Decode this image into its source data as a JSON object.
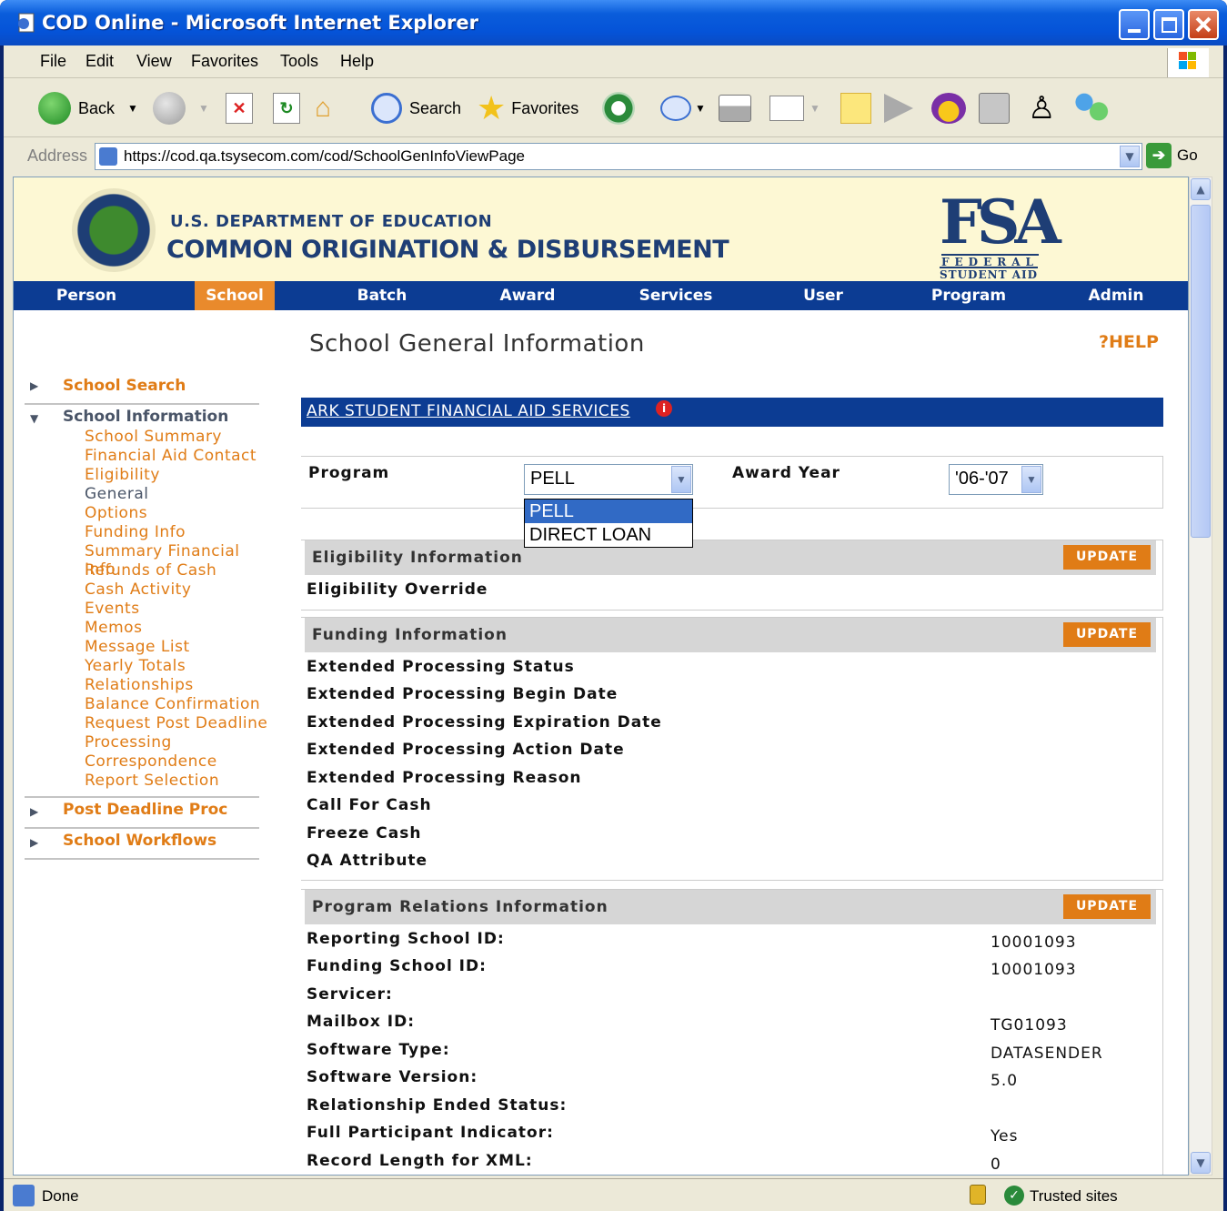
{
  "window": {
    "title": "COD Online - Microsoft Internet Explorer"
  },
  "menu": [
    "File",
    "Edit",
    "View",
    "Favorites",
    "Tools",
    "Help"
  ],
  "toolbar": {
    "back": "Back",
    "search": "Search",
    "favorites": "Favorites"
  },
  "address": {
    "label": "Address",
    "url": "https://cod.qa.tsysecom.com/cod/SchoolGenInfoViewPage",
    "go": "Go"
  },
  "banner": {
    "dept": "U.S. DEPARTMENT OF EDUCATION",
    "title": "COMMON ORIGINATION & DISBURSEMENT",
    "fsa": "FSA",
    "fsa_line1": "FEDERAL",
    "fsa_line2": "STUDENT AID"
  },
  "nav": [
    "Person",
    "School",
    "Batch",
    "Award",
    "Services",
    "User",
    "Program",
    "Admin"
  ],
  "nav_active": "School",
  "sidebar": {
    "school_search": "School Search",
    "school_information": "School Information",
    "links": [
      "School Summary",
      "Financial Aid Contact",
      "Eligibility",
      "General",
      "Options",
      "Funding Info",
      "Summary Financial Info",
      "Refunds of Cash",
      "Cash Activity",
      "Events",
      "Memos",
      "Message List",
      "Yearly Totals",
      "Relationships",
      "Balance Confirmation",
      "Request Post Deadline",
      "Processing",
      "Correspondence",
      "Report Selection"
    ],
    "post_deadline": "Post Deadline Proc",
    "school_workflows": "School Workflows"
  },
  "main": {
    "title": "School General Information",
    "help": "HELP",
    "school_name": "ARK STUDENT FINANCIAL AID SERVICES",
    "program_label": "Program",
    "program_value": "PELL",
    "program_options": [
      "PELL",
      "DIRECT LOAN"
    ],
    "award_year_label": "Award Year",
    "award_year_value": "'06-'07",
    "update_label": "UPDATE"
  },
  "eligibility": {
    "title": "Eligibility Information",
    "fields": [
      "Eligibility Override"
    ]
  },
  "funding": {
    "title": "Funding Information",
    "fields": [
      "Extended Processing Status",
      "Extended Processing Begin Date",
      "Extended Processing Expiration Date",
      "Extended Processing Action Date",
      "Extended Processing Reason",
      "Call For Cash",
      "Freeze Cash",
      "QA Attribute"
    ]
  },
  "relations": {
    "title": "Program Relations Information",
    "fields": [
      "Reporting School ID:",
      "Funding School ID:",
      "Servicer:",
      "Mailbox ID:",
      "Software Type:",
      "Software Version:",
      "Relationship Ended Status:",
      "Full Participant Indicator:",
      "Record Length for XML:"
    ],
    "values": [
      "10001093",
      "10001093",
      "",
      "TG01093",
      "DATASENDER",
      "5.0",
      "",
      "Yes",
      "0"
    ]
  },
  "status": {
    "left": "Done",
    "zone": "Trusted sites"
  }
}
